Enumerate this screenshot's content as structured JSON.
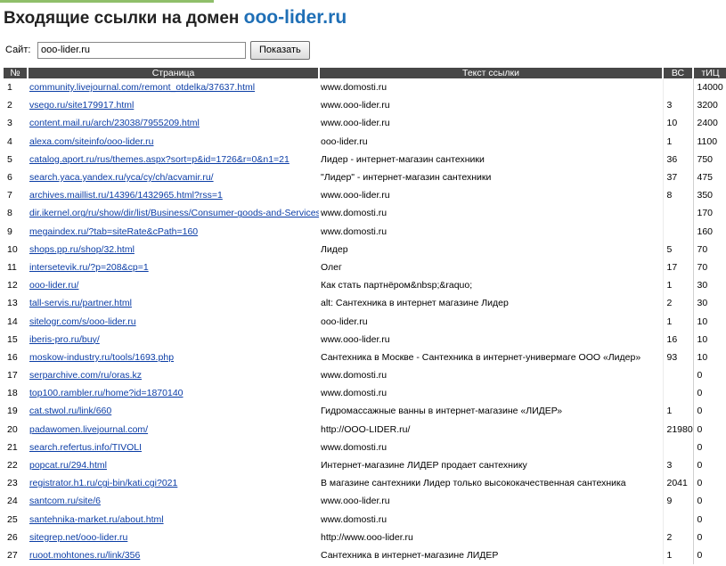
{
  "header": {
    "title": "Входящие ссылки на домен",
    "domain": "ooo-lider.ru"
  },
  "form": {
    "site_label": "Сайт:",
    "site_value": "ooo-lider.ru",
    "submit_label": "Показать"
  },
  "table": {
    "columns": [
      "№",
      "Страница",
      "Текст ссылки",
      "ВС",
      "тИЦ"
    ],
    "rows": [
      {
        "n": "1",
        "page": "community.livejournal.com/remont_otdelka/37637.html",
        "text": "www.domosti.ru",
        "bc": "",
        "tic": "14000"
      },
      {
        "n": "2",
        "page": "vsego.ru/site179917.html",
        "text": "www.ooo-lider.ru",
        "bc": "3",
        "tic": "3200"
      },
      {
        "n": "3",
        "page": "content.mail.ru/arch/23038/7955209.html",
        "text": "www.ooo-lider.ru",
        "bc": "10",
        "tic": "2400"
      },
      {
        "n": "4",
        "page": "alexa.com/siteinfo/ooo-lider.ru",
        "text": "ooo-lider.ru",
        "bc": "1",
        "tic": "1100"
      },
      {
        "n": "5",
        "page": "catalog.aport.ru/rus/themes.aspx?sort=p&id=1726&r=0&n1=21",
        "text": "Лидер - интернет-магазин сантехники",
        "bc": "36",
        "tic": "750"
      },
      {
        "n": "6",
        "page": "search.yaca.yandex.ru/yca/cy/ch/acvamir.ru/",
        "text": "\"Лидер\" - интернет-магазин сантехники",
        "bc": "37",
        "tic": "475"
      },
      {
        "n": "7",
        "page": "archives.maillist.ru/14396/1432965.html?rss=1",
        "text": "www.ooo-lider.ru",
        "bc": "8",
        "tic": "350"
      },
      {
        "n": "8",
        "page": "dir.ikernel.org/ru/show/dir/list/Business/Consumer-goods-and-Services",
        "text": "www.domosti.ru",
        "bc": "",
        "tic": "170"
      },
      {
        "n": "9",
        "page": "megaindex.ru/?tab=siteRate&cPath=160",
        "text": "www.domosti.ru",
        "bc": "",
        "tic": "160"
      },
      {
        "n": "10",
        "page": "shops.pp.ru/shop/32.html",
        "text": "Лидер",
        "bc": "5",
        "tic": "70"
      },
      {
        "n": "11",
        "page": "intersetevik.ru/?p=208&cp=1",
        "text": "Олег",
        "bc": "17",
        "tic": "70"
      },
      {
        "n": "12",
        "page": "ooo-lider.ru/",
        "text": "Как стать партнёром&nbsp;&raquo;",
        "bc": "1",
        "tic": "30"
      },
      {
        "n": "13",
        "page": "tall-servis.ru/partner.html",
        "text": "alt: Сантехника в интернет магазине Лидер",
        "bc": "2",
        "tic": "30"
      },
      {
        "n": "14",
        "page": "sitelogr.com/s/ooo-lider.ru",
        "text": "ooo-lider.ru",
        "bc": "1",
        "tic": "10"
      },
      {
        "n": "15",
        "page": "iberis-pro.ru/buy/",
        "text": "www.ooo-lider.ru",
        "bc": "16",
        "tic": "10"
      },
      {
        "n": "16",
        "page": "moskow-industry.ru/tools/1693.php",
        "text": "Сантехника в Москве - Сантехника в интернет-универмаге ООО «Лидер»",
        "bc": "93",
        "tic": "10"
      },
      {
        "n": "17",
        "page": "serparchive.com/ru/oras.kz",
        "text": "www.domosti.ru",
        "bc": "",
        "tic": "0"
      },
      {
        "n": "18",
        "page": "top100.rambler.ru/home?id=1870140",
        "text": "www.domosti.ru",
        "bc": "",
        "tic": "0"
      },
      {
        "n": "19",
        "page": "cat.stwol.ru/link/660",
        "text": "Гидромассажные ванны в интернет-магазине «ЛИДЕР»",
        "bc": "1",
        "tic": "0"
      },
      {
        "n": "20",
        "page": "padawomen.livejournal.com/",
        "text": "http://OOO-LIDER.ru/",
        "bc": "21980",
        "tic": "0"
      },
      {
        "n": "21",
        "page": "search.refertus.info/TIVOLI",
        "text": "www.domosti.ru",
        "bc": "",
        "tic": "0"
      },
      {
        "n": "22",
        "page": "popcat.ru/294.html",
        "text": "Интернет-магазине ЛИДЕР продает сантехнику",
        "bc": "3",
        "tic": "0"
      },
      {
        "n": "23",
        "page": "registrator.h1.ru/cgi-bin/kati.cgi?021",
        "text": "В магазине сантехники Лидер только высококачественная сантехника",
        "bc": "2041",
        "tic": "0"
      },
      {
        "n": "24",
        "page": "santcom.ru/site/6",
        "text": "www.ooo-lider.ru",
        "bc": "9",
        "tic": "0"
      },
      {
        "n": "25",
        "page": "santehnika-market.ru/about.html",
        "text": "www.domosti.ru",
        "bc": "",
        "tic": "0"
      },
      {
        "n": "26",
        "page": "sitegrep.net/ooo-lider.ru",
        "text": "http://www.ooo-lider.ru",
        "bc": "2",
        "tic": "0"
      },
      {
        "n": "27",
        "page": "ruoot.mohtones.ru/link/356",
        "text": "Сантехника в интернет-магазине ЛИДЕР",
        "bc": "1",
        "tic": "0"
      }
    ]
  }
}
